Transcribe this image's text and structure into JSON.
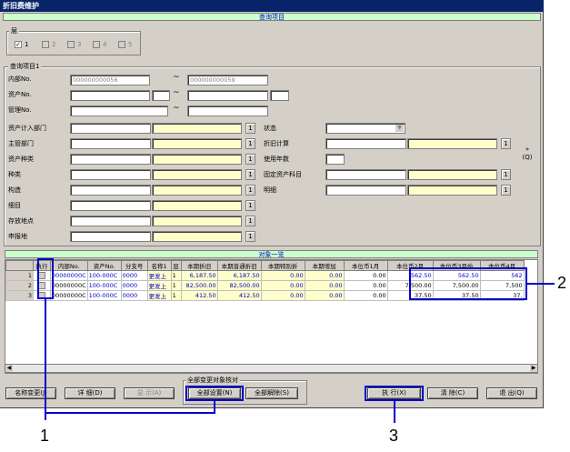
{
  "window": {
    "title": "折旧费维护"
  },
  "query_section": {
    "header": "查询项目"
  },
  "layer": {
    "label": "层",
    "options": [
      {
        "label": "1",
        "checked": true,
        "enabled": true
      },
      {
        "label": "2",
        "checked": false,
        "enabled": false
      },
      {
        "label": "3",
        "checked": false,
        "enabled": false
      },
      {
        "label": "4",
        "checked": false,
        "enabled": false
      },
      {
        "label": "5",
        "checked": false,
        "enabled": false
      }
    ]
  },
  "query_items": {
    "label": "查询项目1",
    "internal_no": {
      "label": "内部No.",
      "from": "000000000056",
      "to": "000000000059"
    },
    "asset_no": {
      "label": "资产No."
    },
    "mgmt_no": {
      "label": "管理No."
    },
    "range_sep": "~",
    "fields": {
      "dept_in": "资产计入部门",
      "main_dept": "主管部门",
      "asset_type": "资产种类",
      "type": "种类",
      "structure": "构造",
      "detail_item": "细目",
      "location": "存放地点",
      "report_place": "申报地",
      "status": "状态",
      "depr_calc": "折旧计算",
      "useful_life": "使用年数",
      "fixed_asset_item": "固定资产科目",
      "detail": "明细"
    },
    "lookup": "1",
    "expand": "»\n(Q)"
  },
  "result_section": {
    "header": "对象一览"
  },
  "grid": {
    "columns": [
      "执行",
      "内部No.",
      "资产No.",
      "分支号",
      "名称1",
      "层",
      "本期折旧",
      "本期普通折旧",
      "本期特别折",
      "本期增加",
      "本位币1月",
      "本位币2月",
      "本位币3月份",
      "本位币4月"
    ],
    "rows": [
      {
        "num": "1",
        "internal": "00000000C",
        "asset": "100-000C",
        "branch": "0000",
        "name": "更发上",
        "layer": "1",
        "depr": "6,187.50",
        "normal": "6,187.50",
        "special": "0.00",
        "increase": "0.00",
        "m1": "0.00",
        "m2": "562.50",
        "m3": "562.50",
        "m4": "562"
      },
      {
        "num": "2",
        "internal": "00000000C",
        "asset": "100-000C",
        "branch": "0000",
        "name": "更发上",
        "layer": "1",
        "depr": "82,500.00",
        "normal": "82,500.00",
        "special": "0.00",
        "increase": "0.00",
        "m1": "0.00",
        "m2": "7,500.00",
        "m3": "7,500.00",
        "m4": "7,500"
      },
      {
        "num": "3",
        "internal": "00000000C",
        "asset": "100-000C",
        "branch": "0000",
        "name": "更发上",
        "layer": "1",
        "depr": "412.50",
        "normal": "412.50",
        "special": "0.00",
        "increase": "0.00",
        "m1": "0.00",
        "m2": "37.50",
        "m3": "37.50",
        "m4": "37."
      }
    ]
  },
  "bulk_group": {
    "label": "全部变更对象核对"
  },
  "buttons": {
    "name_change": "名称变更(J)",
    "detail": "详 细(D)",
    "display": "显 示(A)",
    "set_all": "全部设置(N)",
    "clear_all": "全部解除(S)",
    "execute": "执 行(X)",
    "clear": "清 除(C)",
    "exit": "退 出(Q)"
  },
  "callouts": {
    "one": "1",
    "two": "2",
    "three": "3"
  },
  "colors": {
    "title_bar": "#0a246a",
    "section_header": "#ccffcc",
    "highlight": "#0000cc",
    "yellow_field": "#ffffcc"
  }
}
